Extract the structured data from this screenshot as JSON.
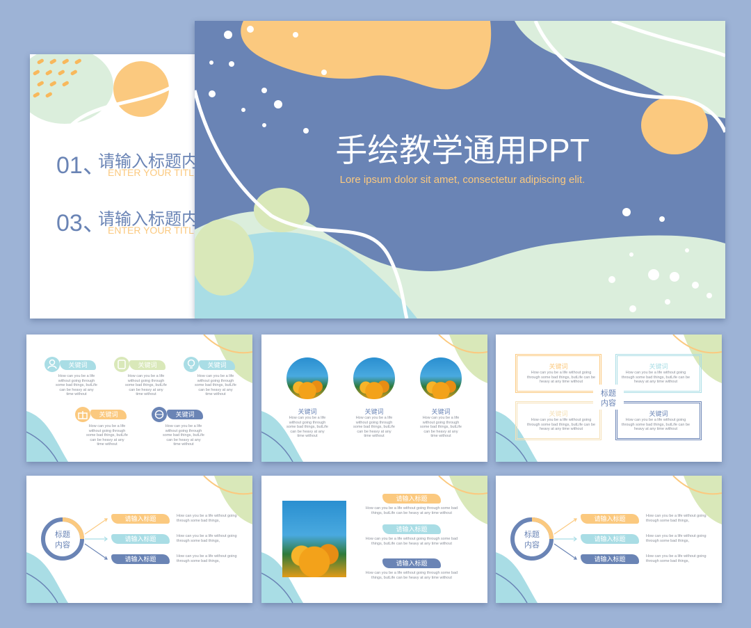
{
  "colors": {
    "background": "#9db3d6",
    "blue": "#6a84b5",
    "orange": "#fbc97f",
    "mint": "#dbeedc",
    "lightblue": "#a9dde5",
    "green": "#d9e8b9"
  },
  "hero": {
    "title": "手绘教学通用PPT",
    "subtitle": "Lore ipsum dolor sit amet, consectetur adipiscing elit."
  },
  "toc": {
    "items": [
      {
        "number": "01、",
        "title": "请输入标题内",
        "subtitle": "ENTER YOUR TITLE"
      },
      {
        "number": "03、",
        "title": "请输入标题内",
        "subtitle": "ENTER YOUR TITLE"
      }
    ]
  },
  "slide_icons": {
    "keyword": "关键词",
    "body": "How can you be a life without going through some bad things, butLife can be heavy at any time without",
    "icons": [
      "user-icon",
      "phone-icon",
      "bulb-icon",
      "gift-icon",
      "globe-icon"
    ]
  },
  "slide_circles": {
    "keyword": "关键词",
    "body": "How can you be a life without going through some bad things, butLife can be heavy at any time without"
  },
  "slide_boxes": {
    "keyword": "关键词",
    "center_title": "标题\n内容",
    "center_line1": "标题",
    "center_line2": "内容",
    "body": "How can you be a life without going through some bad things, butLife can be heavy at any time without"
  },
  "slide_arrows": {
    "center_line1": "标题",
    "center_line2": "内容",
    "label": "请输入标题",
    "body": "How can you be a life without going through some bad things,"
  },
  "slide_photo": {
    "label": "请输入标题",
    "body": "How can you be a life without going through some bad things, butLife can be heavy at any time without"
  }
}
